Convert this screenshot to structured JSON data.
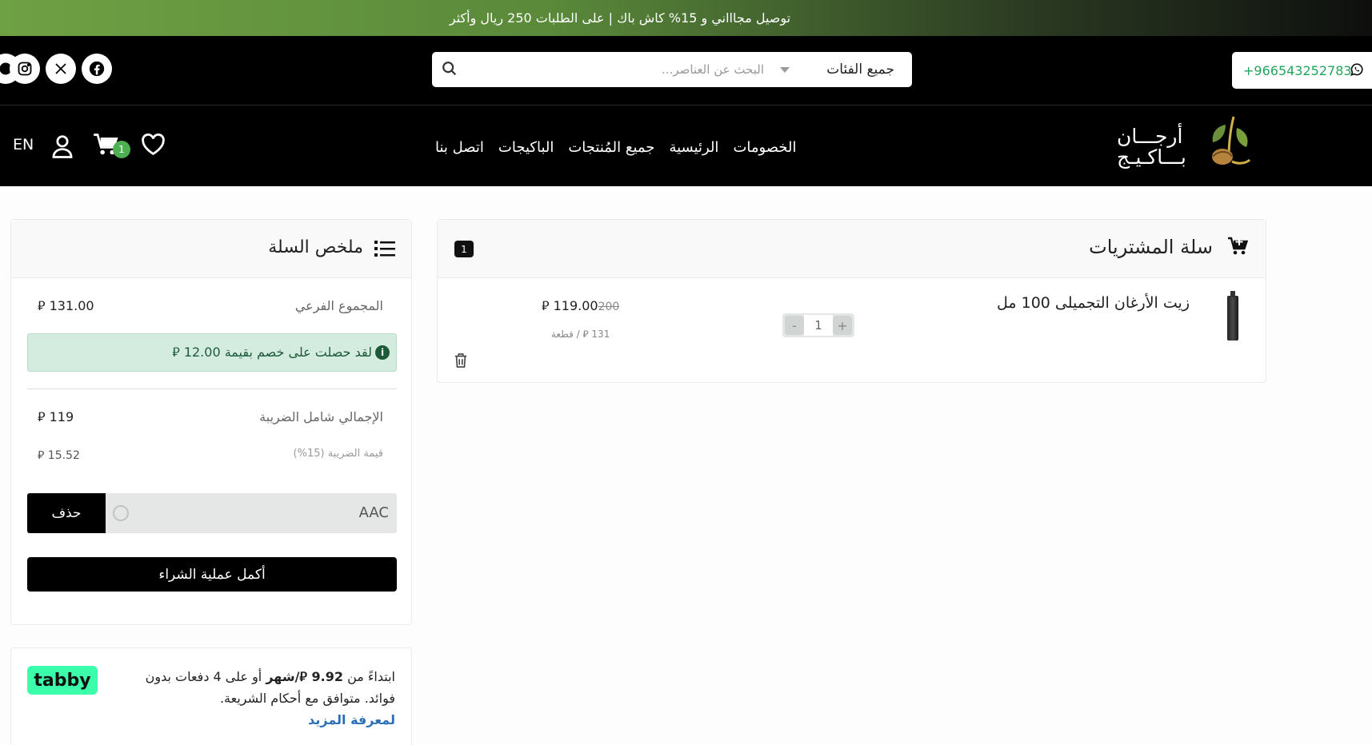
{
  "promo": {
    "text": "توصيل مجاااني و 15% كاش باك | على الطلبات 250 ريال وأكثر"
  },
  "topbar": {
    "categories_label": "جميع الفئات",
    "search_placeholder": "البحث عن العناصر...",
    "phone": "+966543252783",
    "social": [
      "facebook-icon",
      "x-icon",
      "instagram-icon"
    ]
  },
  "nav": {
    "lang": "EN",
    "cart_count": "1",
    "items": [
      "اتصل بنا",
      "الباكيجات",
      "جميع المُنتجات",
      "الرئيسية",
      "الخصومات"
    ],
    "logo_line1": "أرجـــان",
    "logo_line2": "بـــاكـيـج"
  },
  "cart": {
    "title": "سلة المشتريات",
    "count": "1",
    "item": {
      "name": "زيت الأرغان التجميلى 100 مل",
      "quantity": "1",
      "minus": "-",
      "plus": "+",
      "old_price": "200",
      "price": "119.00 ⃁",
      "unit_price": "131 ⃁ / قطعة"
    }
  },
  "summary": {
    "title": "ملخص السلة",
    "subtotal_label": "المجموع الفرعي",
    "subtotal_value": "131.00 ⃁",
    "discount_text": "لقد حصلت على خصم بقيمة 12.00 ⃁",
    "total_label": "الإجمالي شامل الضريبة",
    "total_value": "119 ⃁",
    "tax_label": "قيمة الضريبة (15%)",
    "tax_value": "15.52 ⃁",
    "coupon_code": "AAC",
    "remove_label": "حذف",
    "checkout_label": "أكمل عملية الشراء"
  },
  "tabby": {
    "text_prefix": "ابتداءً من ",
    "amount": "9.92 ⃁/شهر",
    "text_suffix": " أو على 4 دفعات بدون فوائد. متوافق مع أحكام الشريعة.",
    "learn_more": "لمعرفة المزيد",
    "logo": "tabby"
  },
  "colors": {
    "accent_green": "#4caf50",
    "promo_green": "#6fa044",
    "whatsapp_green": "#22a45d"
  }
}
